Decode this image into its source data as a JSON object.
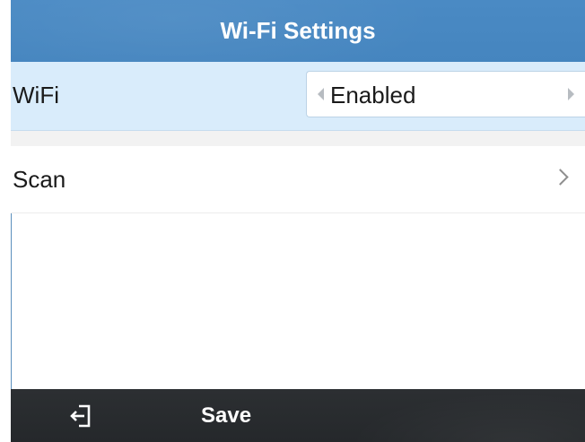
{
  "header": {
    "title": "Wi-Fi Settings"
  },
  "rows": {
    "wifi": {
      "label": "WiFi",
      "value": "Enabled"
    },
    "scan": {
      "label": "Scan"
    }
  },
  "softkeys": {
    "back_icon": "back-exit-icon",
    "save_label": "Save"
  },
  "colors": {
    "title_bar": "#4a8ac4",
    "selected_row": "#d9ecfb",
    "softkey_bar": "#2a2d30"
  }
}
